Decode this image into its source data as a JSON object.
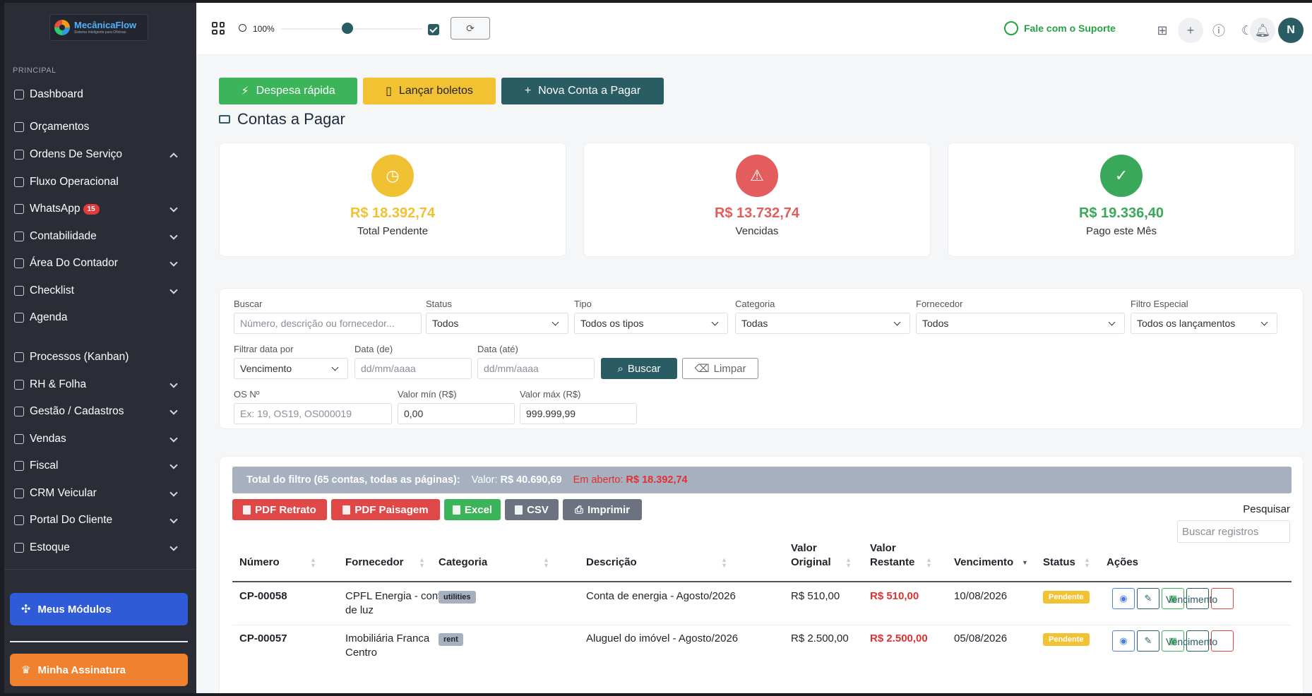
{
  "sidebar": {
    "brand": {
      "name": "MecânicaFlow",
      "tagline": "Sistema Inteligente para Oficinas"
    },
    "section_label": "PRINCIPAL",
    "items": [
      {
        "label": "Dashboard",
        "chevron": "none"
      },
      {
        "label": "Orçamentos",
        "chevron": "none"
      },
      {
        "label": "Ordens De Serviço",
        "chevron": "up"
      },
      {
        "label": "Fluxo Operacional",
        "chevron": "none"
      },
      {
        "label": "WhatsApp",
        "badge": "15",
        "chevron": "down"
      },
      {
        "label": "Contabilidade",
        "chevron": "down"
      },
      {
        "label": "Área Do Contador",
        "chevron": "down"
      },
      {
        "label": "Checklist",
        "chevron": "down"
      },
      {
        "label": "Agenda",
        "chevron": "none"
      },
      {
        "label": "Processos (Kanban)",
        "chevron": "none"
      },
      {
        "label": "RH & Folha",
        "chevron": "down"
      },
      {
        "label": "Gestão / Cadastros",
        "chevron": "down"
      },
      {
        "label": "Vendas",
        "chevron": "down"
      },
      {
        "label": "Fiscal",
        "chevron": "down"
      },
      {
        "label": "CRM Veicular",
        "chevron": "down"
      },
      {
        "label": "Portal Do Cliente",
        "chevron": "down"
      },
      {
        "label": "Estoque",
        "chevron": "down"
      }
    ],
    "modules_button": "Meus Módulos",
    "subscription_button": "Minha Assinatura"
  },
  "topbar": {
    "zoom": "100%",
    "zoom_fraction": 0.47,
    "checkbox_checked": true,
    "support_label": "Fale com o Suporte",
    "avatar_initial": "N"
  },
  "actions": {
    "quick_expense": "Despesa rápida",
    "boletos": "Lançar boletos",
    "new_payable": "Nova Conta a Pagar"
  },
  "page_title": "Contas a Pagar",
  "stats": [
    {
      "value": "R$ 18.392,74",
      "label": "Total Pendente",
      "color": "#f0c233",
      "icon": "clock-icon"
    },
    {
      "value": "R$ 13.732,74",
      "label": "Vencidas",
      "color": "#e35d5d",
      "icon": "warning-icon"
    },
    {
      "value": "R$ 19.336,40",
      "label": "Pago este Mês",
      "color": "#3aa85a",
      "icon": "check-icon"
    }
  ],
  "filters": {
    "buscar": {
      "label": "Buscar",
      "placeholder": "Número, descrição ou fornecedor..."
    },
    "status": {
      "label": "Status",
      "value": "Todos"
    },
    "tipo": {
      "label": "Tipo",
      "value": "Todos os tipos"
    },
    "categoria": {
      "label": "Categoria",
      "value": "Todas"
    },
    "fornecedor": {
      "label": "Fornecedor",
      "value": "Todos"
    },
    "filtro_especial": {
      "label": "Filtro Especial",
      "value": "Todos os lançamentos"
    },
    "filtrar_data": {
      "label": "Filtrar data por",
      "value": "Vencimento"
    },
    "data_de": {
      "label": "Data (de)",
      "placeholder": "dd/mm/aaaa"
    },
    "data_ate": {
      "label": "Data (até)",
      "placeholder": "dd/mm/aaaa"
    },
    "buscar_btn": "Buscar",
    "limpar_btn": "Limpar",
    "os": {
      "label": "OS Nº",
      "placeholder": "Ex: 19, OS19, OS000019"
    },
    "valor_min": {
      "label": "Valor mín (R$)",
      "placeholder": "0,00"
    },
    "valor_max": {
      "label": "Valor máx (R$)",
      "placeholder": "999.999,99"
    }
  },
  "table": {
    "total_label": "Total do filtro (65 contas, todas as páginas):",
    "valor_label": "Valor:",
    "valor": "R$ 40.690,69",
    "aberto_label": "Em aberto:",
    "aberto": "R$ 18.392,74",
    "export": {
      "pdf_retrato": "PDF Retrato",
      "pdf_paisagem": "PDF Paisagem",
      "excel": "Excel",
      "csv": "CSV",
      "imprimir": "Imprimir"
    },
    "search_label": "Pesquisar",
    "search_placeholder": "Buscar registros",
    "columns": {
      "numero": "Número",
      "fornecedor": "Fornecedor",
      "categoria": "Categoria",
      "descricao": "Descrição",
      "valor_original_1": "Valor",
      "valor_original_2": "Original",
      "valor_restante_1": "Valor",
      "valor_restante_2": "Restante",
      "vencimento": "Vencimento",
      "status": "Status",
      "acoes": "Ações"
    },
    "rows": [
      {
        "numero": "CP-00058",
        "fornecedor_1": "CPFL Energia - conta",
        "fornecedor_2": "de luz",
        "categoria": "utilities",
        "descricao": "Conta de energia - Agosto/2026",
        "valor_original": "R$ 510,00",
        "valor_restante": "R$ 510,00",
        "vencimento": "10/08/2026",
        "status": "Pendente",
        "action_label": "Vencimento"
      },
      {
        "numero": "CP-00057",
        "fornecedor_1": "Imobiliária Franca",
        "fornecedor_2": "Centro",
        "categoria": "rent",
        "descricao": "Aluguel do imóvel - Agosto/2026",
        "valor_original": "R$ 2.500,00",
        "valor_restante": "R$ 2.500,00",
        "vencimento": "05/08/2026",
        "status": "Pendente",
        "action_label": "Vencimento"
      }
    ]
  }
}
